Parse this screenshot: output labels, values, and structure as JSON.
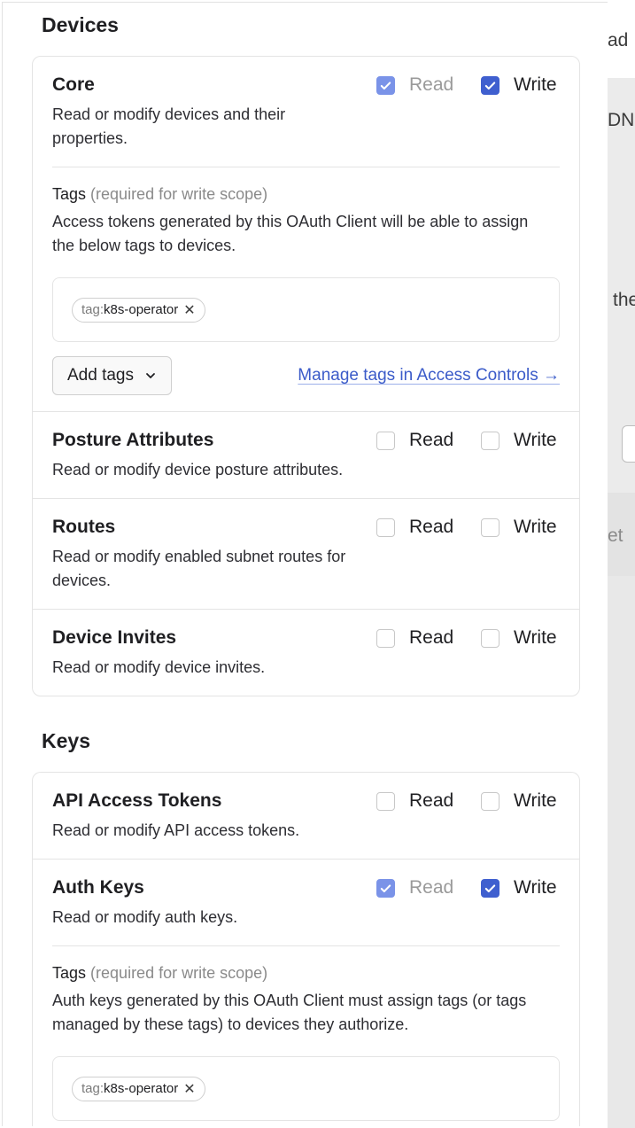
{
  "background": {
    "fragments": [
      "ad",
      "DN",
      "the",
      "et"
    ]
  },
  "devices": {
    "section_title": "Devices",
    "core": {
      "title": "Core",
      "description": "Read or modify devices and their properties.",
      "read_label": "Read",
      "write_label": "Write",
      "read_checked": true,
      "write_checked": true,
      "tags_label": "Tags",
      "tags_note": "(required for write scope)",
      "tags_description": "Access tokens generated by this OAuth Client will be able to assign the below tags to devices.",
      "tag_prefix": "tag:",
      "tag_name": "k8s-operator",
      "add_tags_label": "Add tags",
      "manage_link": "Manage tags in Access Controls →"
    },
    "posture": {
      "title": "Posture Attributes",
      "description": "Read or modify device posture attributes.",
      "read_label": "Read",
      "write_label": "Write"
    },
    "routes": {
      "title": "Routes",
      "description": "Read or modify enabled subnet routes for devices.",
      "read_label": "Read",
      "write_label": "Write"
    },
    "invites": {
      "title": "Device Invites",
      "description": "Read or modify device invites.",
      "read_label": "Read",
      "write_label": "Write"
    }
  },
  "keys": {
    "section_title": "Keys",
    "api_tokens": {
      "title": "API Access Tokens",
      "description": "Read or modify API access tokens.",
      "read_label": "Read",
      "write_label": "Write"
    },
    "auth_keys": {
      "title": "Auth Keys",
      "description": "Read or modify auth keys.",
      "read_label": "Read",
      "write_label": "Write",
      "read_checked": true,
      "write_checked": true,
      "tags_label": "Tags",
      "tags_note": "(required for write scope)",
      "tags_description": "Auth keys generated by this OAuth Client must assign tags (or tags managed by these tags) to devices they authorize.",
      "tag_prefix": "tag:",
      "tag_name": "k8s-operator"
    }
  },
  "colors": {
    "accent": "#3f5fcf",
    "accent_dim": "#7a93e8",
    "link": "#3b5bc9"
  }
}
